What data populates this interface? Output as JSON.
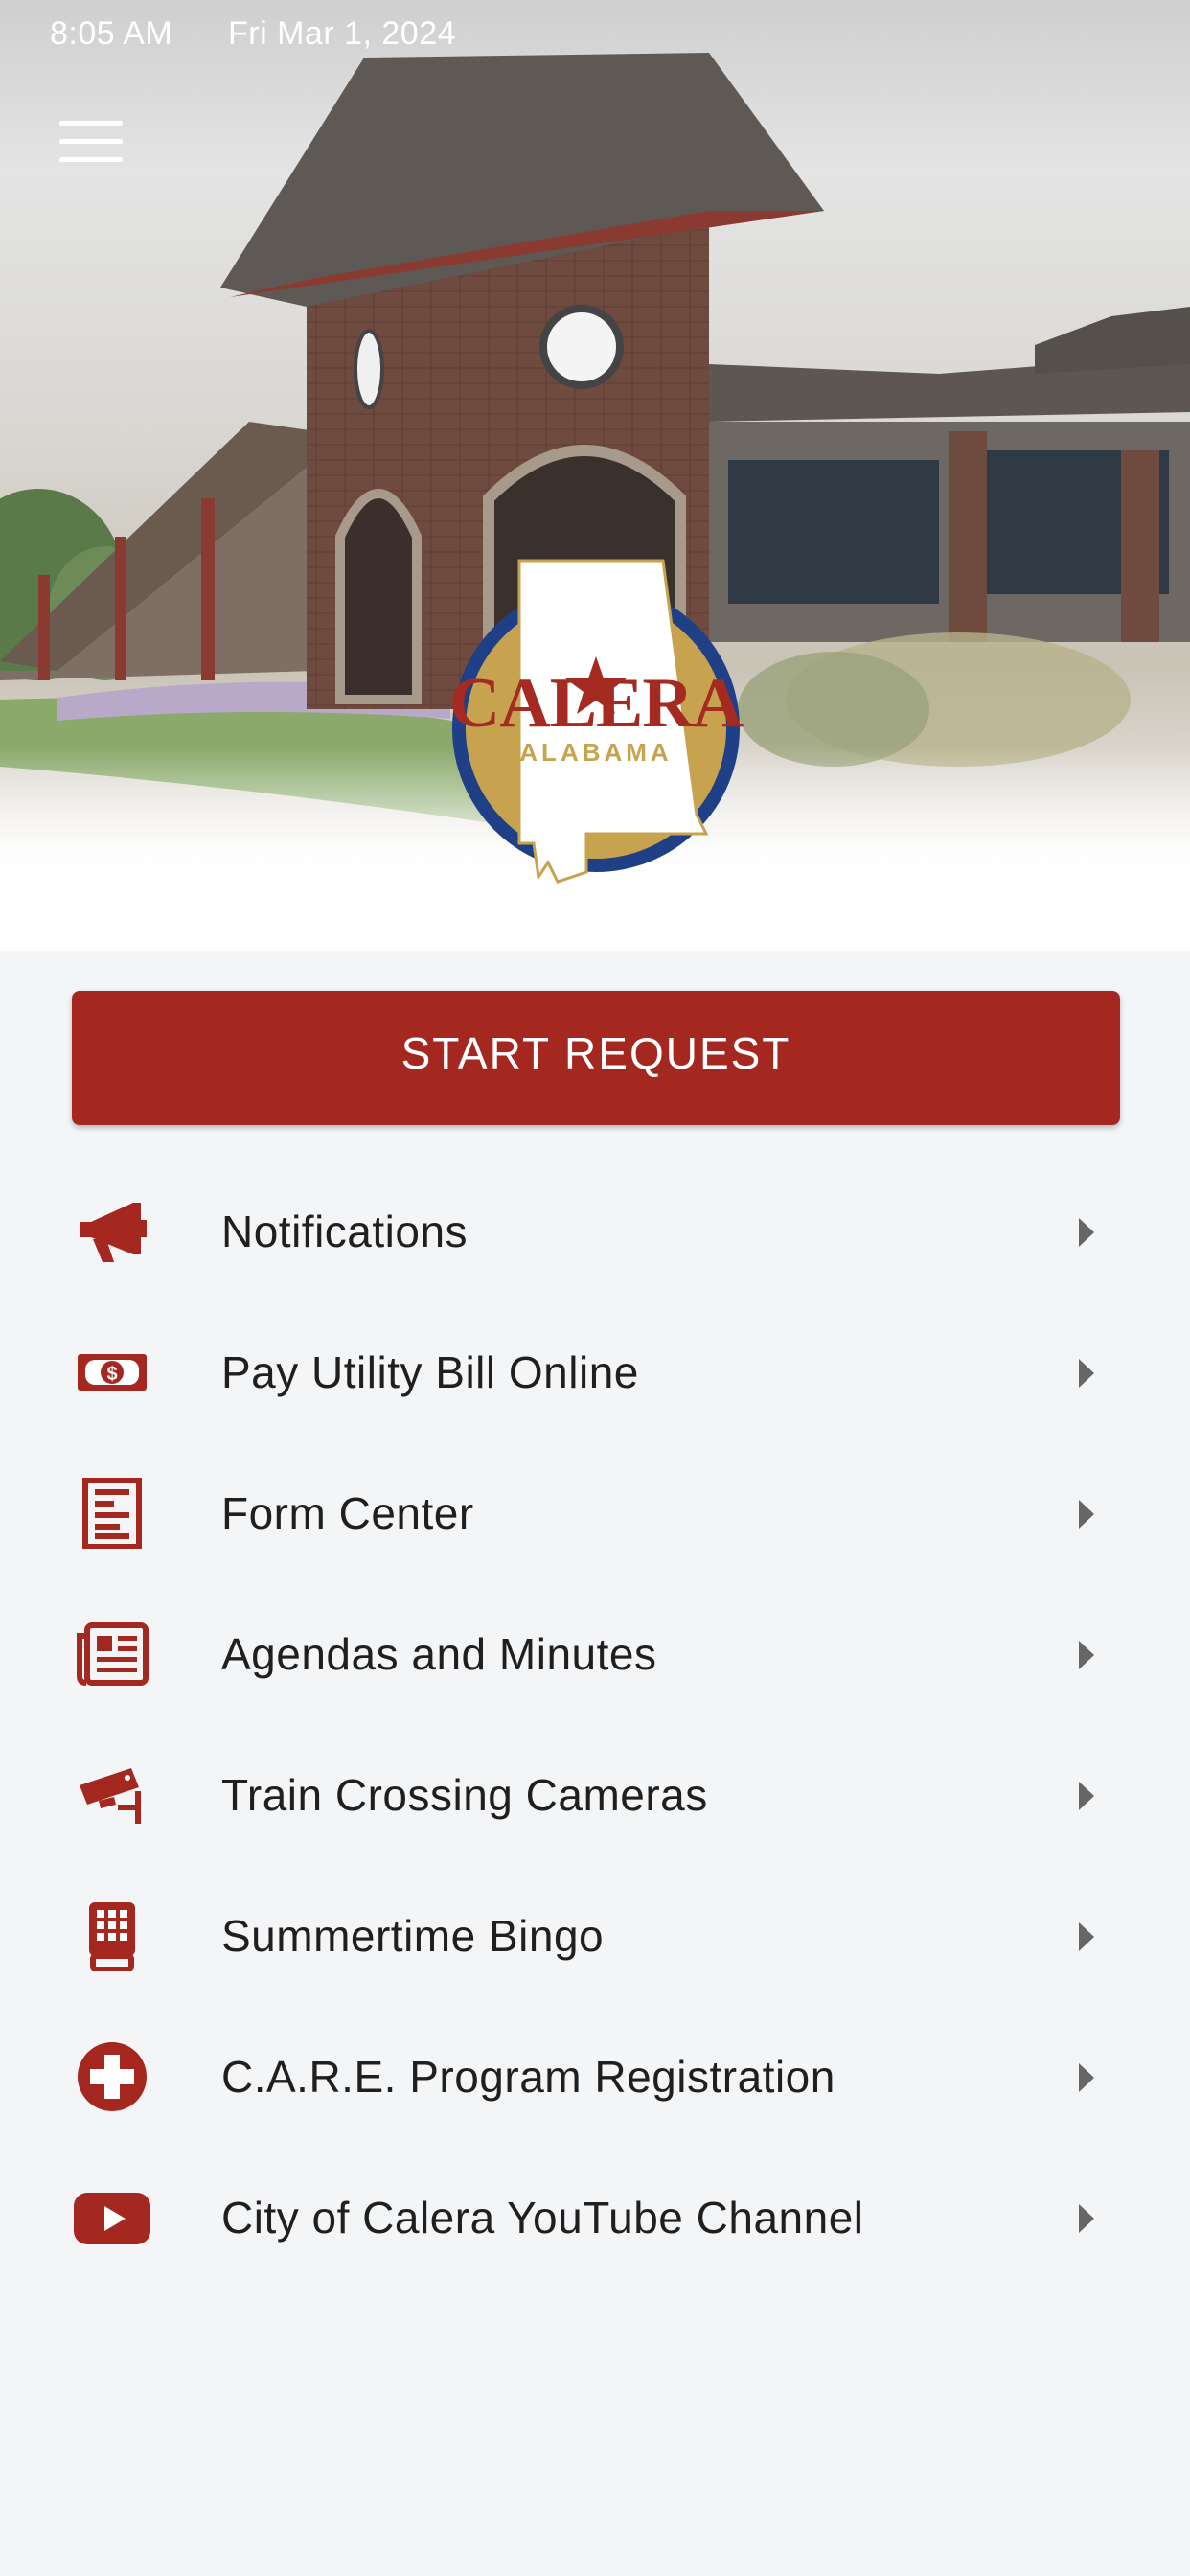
{
  "status_bar": {
    "time": "8:05 AM",
    "date": "Fri Mar 1, 2024"
  },
  "header": {
    "menu_icon": "hamburger-menu-icon"
  },
  "logo": {
    "word": "CALERA",
    "sub": "ALABAMA"
  },
  "start_request": {
    "label": "START REQUEST"
  },
  "menu": {
    "items": [
      {
        "label": "Notifications",
        "icon": "megaphone-icon"
      },
      {
        "label": "Pay Utility Bill Online",
        "icon": "money-bill-icon"
      },
      {
        "label": "Form Center",
        "icon": "form-icon"
      },
      {
        "label": "Agendas and Minutes",
        "icon": "newspaper-icon"
      },
      {
        "label": "Train Crossing Cameras",
        "icon": "security-camera-icon"
      },
      {
        "label": "Summertime Bingo",
        "icon": "keypad-icon"
      },
      {
        "label": "C.A.R.E. Program Registration",
        "icon": "plus-circle-icon"
      },
      {
        "label": "City of Calera YouTube Channel",
        "icon": "youtube-icon"
      }
    ]
  },
  "colors": {
    "brand_red": "#a52820",
    "background": "#f4f5f7",
    "logo_gold": "#c7a350",
    "logo_blue": "#1f3f86"
  }
}
